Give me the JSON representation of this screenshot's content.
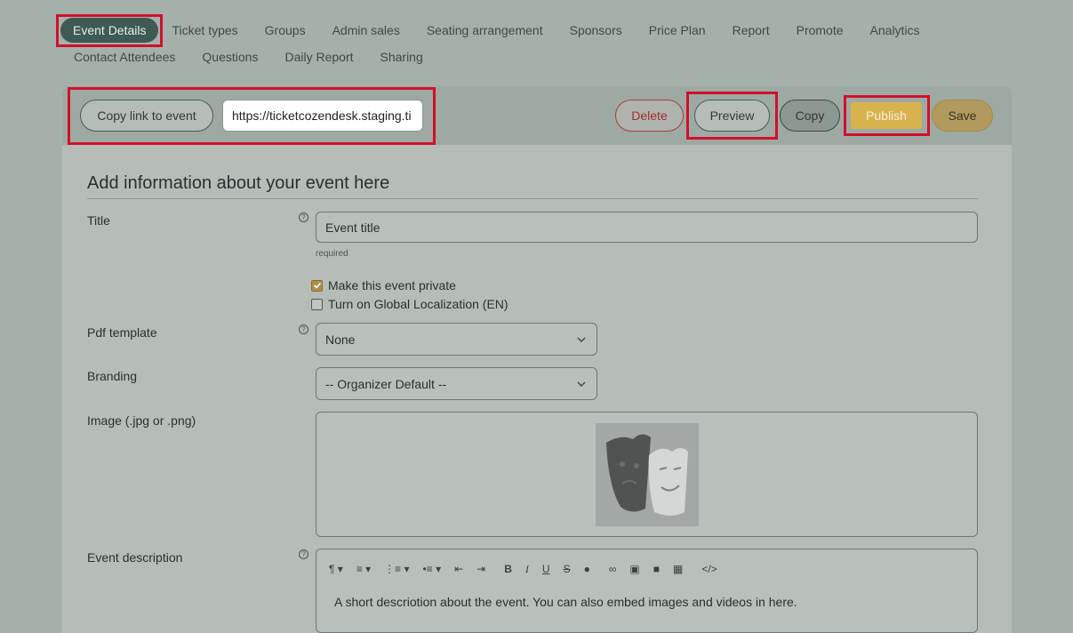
{
  "nav": {
    "row1": [
      "Event Details",
      "Ticket types",
      "Groups",
      "Admin sales",
      "Seating arrangement",
      "Sponsors",
      "Price Plan",
      "Report",
      "Promote",
      "Analytics"
    ],
    "row2": [
      "Contact Attendees",
      "Questions",
      "Daily Report",
      "Sharing"
    ]
  },
  "toolbar": {
    "copy_link_label": "Copy link to event",
    "link_value": "https://ticketcozendesk.staging.ti",
    "delete_label": "Delete",
    "preview_label": "Preview",
    "copy_label": "Copy",
    "publish_label": "Publish",
    "save_label": "Save"
  },
  "form": {
    "section_title": "Add information about your event here",
    "title_label": "Title",
    "title_value": "Event title",
    "title_hint": "required",
    "private_label": "Make this event private",
    "private_checked": true,
    "localization_label": "Turn on Global Localization (EN)",
    "localization_checked": false,
    "pdf_label": "Pdf template",
    "pdf_value": "None",
    "branding_label": "Branding",
    "branding_value": "-- Organizer Default --",
    "image_label": "Image (.jpg or .png)",
    "description_label": "Event description",
    "description_value": "A short descriotion about the event. You can also embed images and videos in here."
  },
  "editor_tools": [
    "paragraph-icon",
    "align-icon",
    "ordered-list-icon",
    "unordered-list-icon",
    "outdent-icon",
    "indent-icon",
    "bold-icon",
    "italic-icon",
    "underline-icon",
    "strikethrough-icon",
    "color-icon",
    "link-icon",
    "image-icon",
    "video-icon",
    "table-icon",
    "code-icon"
  ],
  "colors": {
    "highlight": "#d0102b",
    "active_tab": "#3e5a52",
    "publish": "#d8b24c"
  }
}
